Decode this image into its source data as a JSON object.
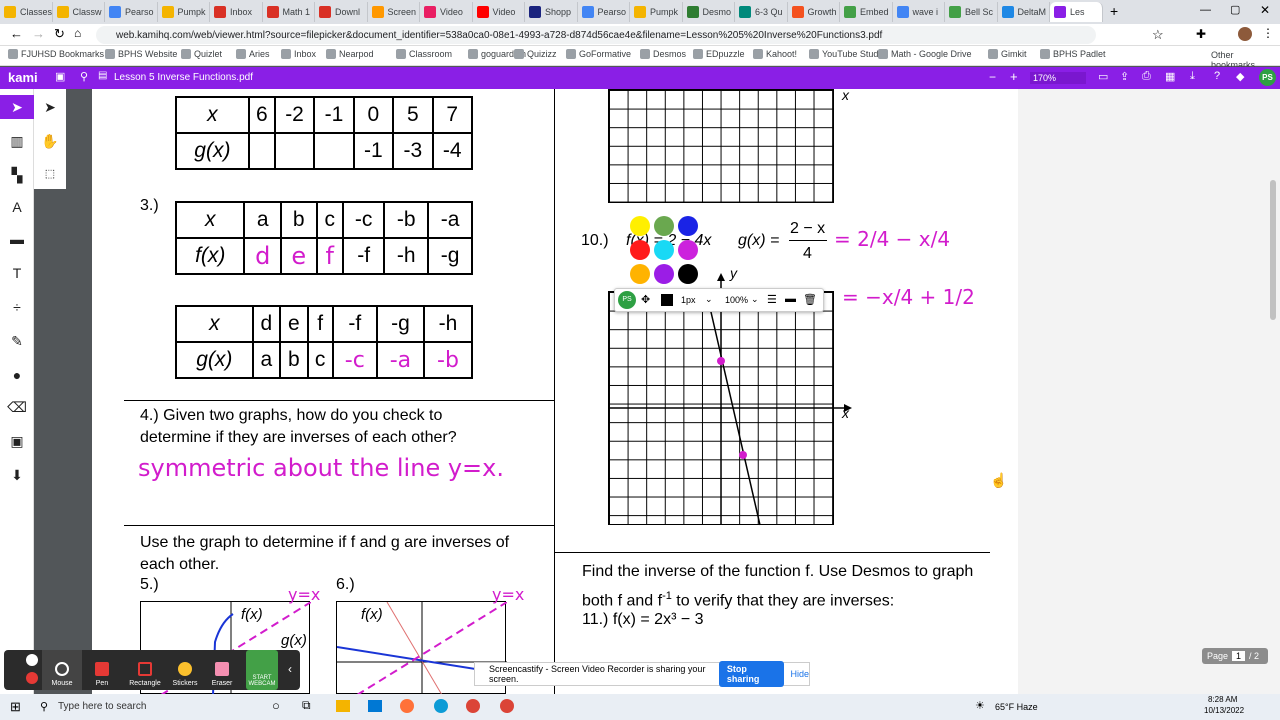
{
  "browser": {
    "tabs": [
      {
        "label": "Classes",
        "color": "#f4b400"
      },
      {
        "label": "Classw",
        "color": "#f4b400"
      },
      {
        "label": "Pearso",
        "color": "#4285f4"
      },
      {
        "label": "Pumpk",
        "color": "#f4b400"
      },
      {
        "label": "Inbox",
        "color": "#d93025"
      },
      {
        "label": "Math 1",
        "color": "#d93025"
      },
      {
        "label": "Downl",
        "color": "#d93025"
      },
      {
        "label": "Screen",
        "color": "#ff9800"
      },
      {
        "label": "Video",
        "color": "#e91e63"
      },
      {
        "label": "Video",
        "color": "#ff0000"
      },
      {
        "label": "Shopp",
        "color": "#1a237e"
      },
      {
        "label": "Pearso",
        "color": "#4285f4"
      },
      {
        "label": "Pumpk",
        "color": "#f4b400"
      },
      {
        "label": "Desmo",
        "color": "#2e7d32"
      },
      {
        "label": "6-3 Qu",
        "color": "#00897b"
      },
      {
        "label": "Growth",
        "color": "#f4511e"
      },
      {
        "label": "Embed",
        "color": "#43a047"
      },
      {
        "label": "wave i",
        "color": "#4285f4"
      },
      {
        "label": "Bell Sc",
        "color": "#43a047"
      },
      {
        "label": "DeltaM",
        "color": "#1e88e5"
      },
      {
        "label": "Les",
        "color": "#8a1fe6"
      }
    ],
    "url": "web.kamihq.com/web/viewer.html?source=filepicker&document_identifier=538a0ca0-08e1-4993-a728-d874d56cae4e&filename=Lesson%205%20Inverse%20Functions3.pdf",
    "bookmarks": [
      "FJUHSD Bookmarks",
      "BPHS Website",
      "Quizlet",
      "Aries",
      "Inbox",
      "Nearpod",
      "Classroom",
      "goguardian",
      "Quizizz",
      "GoFormative",
      "Desmos",
      "EDpuzzle",
      "Kahoot!",
      "YouTube Studio",
      "Math - Google Drive",
      "Gimkit",
      "BPHS Padlet"
    ],
    "other_bookmarks": "Other bookmarks"
  },
  "kami": {
    "logo": "kami",
    "doc_title": "Lesson 5 Inverse Functions.pdf",
    "zoom": "170%",
    "avatar": "PS",
    "accent": "#8a1fe6"
  },
  "doc": {
    "table_g_top": {
      "x": [
        "x",
        "6",
        "-2",
        "-1",
        "0",
        "5",
        "7"
      ],
      "y": [
        "g(x)",
        "",
        "",
        "",
        "-1",
        "-3",
        "-4"
      ]
    },
    "q3_label": "3.)",
    "table_f": {
      "x": [
        "x",
        "a",
        "b",
        "c",
        "-c",
        "-b",
        "-a"
      ],
      "y": [
        "f(x)",
        "d",
        "e",
        "f",
        "-f",
        "-h",
        "-g"
      ]
    },
    "table_g": {
      "x": [
        "x",
        "d",
        "e",
        "f",
        "-f",
        "-g",
        "-h"
      ],
      "y": [
        "g(x)",
        "a",
        "b",
        "c",
        "-c",
        "-a",
        "-b"
      ]
    },
    "q4_text": "4.) Given two graphs, how do you check to determine if they are inverses of each other?",
    "q4_answer": "symmetric about the line y=x.",
    "graph_prompt": "Use the graph to determine if f and g are inverses of each other.",
    "q5": "5.)",
    "q6": "6.)",
    "fx_label": "f(x)",
    "gx_label": "g(x)",
    "yx_label": "y=x",
    "q10": "10.)",
    "q10_fx": "f(x) = 2 − 4x",
    "q10_gx": "g(x) =",
    "q10_num": "2 − x",
    "q10_den": "4",
    "ink_eq1": "= 2/4 − x/4",
    "ink_eq2": "= −x/4 + 1/2",
    "y_axis": "y",
    "x_axis": "x",
    "find_inverse": "Find the inverse of the function f. Use Desmos to graph both f and f",
    "find_inverse2": "to verify that they are inverses:",
    "q11": "11.)  f(x) = 2x³ − 3"
  },
  "annot_toolbar": {
    "avatar": "PS",
    "stroke": "1px",
    "opacity": "100%"
  },
  "swatches": [
    "#ffef00",
    "#6aa84f",
    "#1a23e6",
    "#ff1a1a",
    "#19d9f5",
    "#cc22dd",
    "#ffb300",
    "#9b1de6",
    "#000000"
  ],
  "page_indicator": {
    "label": "Page",
    "current": "1",
    "total": "/ 2"
  },
  "screencastify": {
    "tools": [
      "Mouse",
      "Pen",
      "Rectangle",
      "Stickers",
      "Eraser",
      "START WEBCAM"
    ],
    "share_text": "Screencastify - Screen Video Recorder is sharing your screen.",
    "stop": "Stop sharing",
    "hide": "Hide"
  },
  "taskbar": {
    "search": "Type here to search",
    "weather": "65°F Haze",
    "time": "8:28 AM",
    "date": "10/13/2022"
  }
}
